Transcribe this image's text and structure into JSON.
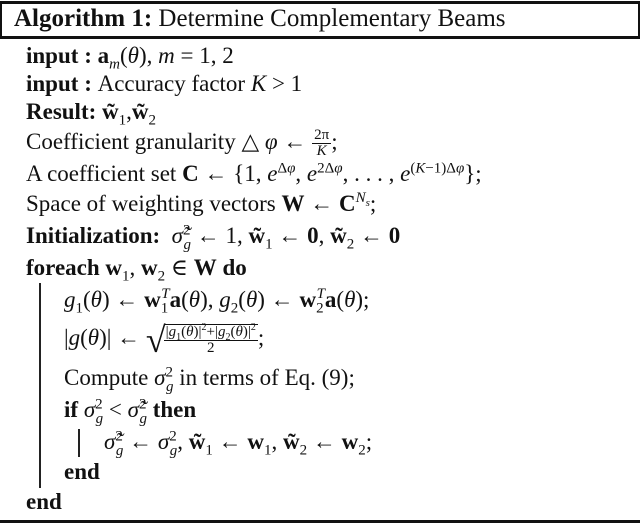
{
  "algorithm": {
    "label": "Algorithm 1:",
    "title": "Determine Complementary Beams"
  },
  "lines": [
    {
      "keyword": "input :",
      "text": "a_m(θ), m = 1, 2"
    },
    {
      "keyword": "input :",
      "text": "Accuracy factor K > 1"
    },
    {
      "keyword": "Result:",
      "text": "w̃1, w̃2"
    },
    {
      "keyword": "",
      "text": "Coefficient granularity △ φ ← 2π/K;"
    },
    {
      "keyword": "",
      "text": "A coefficient set C ← {1, e^{Δφ}, e^{2Δφ}, . . . , e^{(K−1)Δφ}};"
    },
    {
      "keyword": "",
      "text": "Space of weighting vectors W ← C^{N_s};"
    },
    {
      "keyword": "Initialization:",
      "text": "σ̃g² ← 1, w̃1 ← 0, w̃2 ← 0"
    },
    {
      "keyword": "foreach",
      "text": "w1, w2 ∈ W do"
    },
    {
      "keyword": "",
      "text": "g1(θ) ← w1^T a(θ), g2(θ) ← w2^T a(θ);"
    },
    {
      "keyword": "",
      "text": "|g(θ)| ← sqrt((|g1(θ)|² + |g2(θ)|²)/2);"
    },
    {
      "keyword": "",
      "text": "Compute σg² in terms of Eq. (9);"
    },
    {
      "keyword": "if",
      "text": "σg² < σ̃g² then"
    },
    {
      "keyword": "",
      "text": "σ̃g² ← σg², w̃1 ← w1, w̃2 ← w2;"
    },
    {
      "keyword": "end",
      "text": ""
    },
    {
      "keyword": "end",
      "text": ""
    }
  ],
  "tokens": {
    "input_kw": "input",
    "colon": " : ",
    "result_kw": "Result:",
    "init_kw": "Initialization:",
    "foreach_kw": "foreach",
    "do_kw": "do",
    "if_kw": "if",
    "then_kw": "then",
    "end_kw": "end",
    "accuracy_text": "Accuracy factor ",
    "granularity_text": "Coefficient granularity ",
    "coef_set_text": "A coefficient set ",
    "space_text": "Space of weighting vectors ",
    "compute_text": "Compute ",
    "in_terms_text": " in terms of Eq. (9);"
  }
}
